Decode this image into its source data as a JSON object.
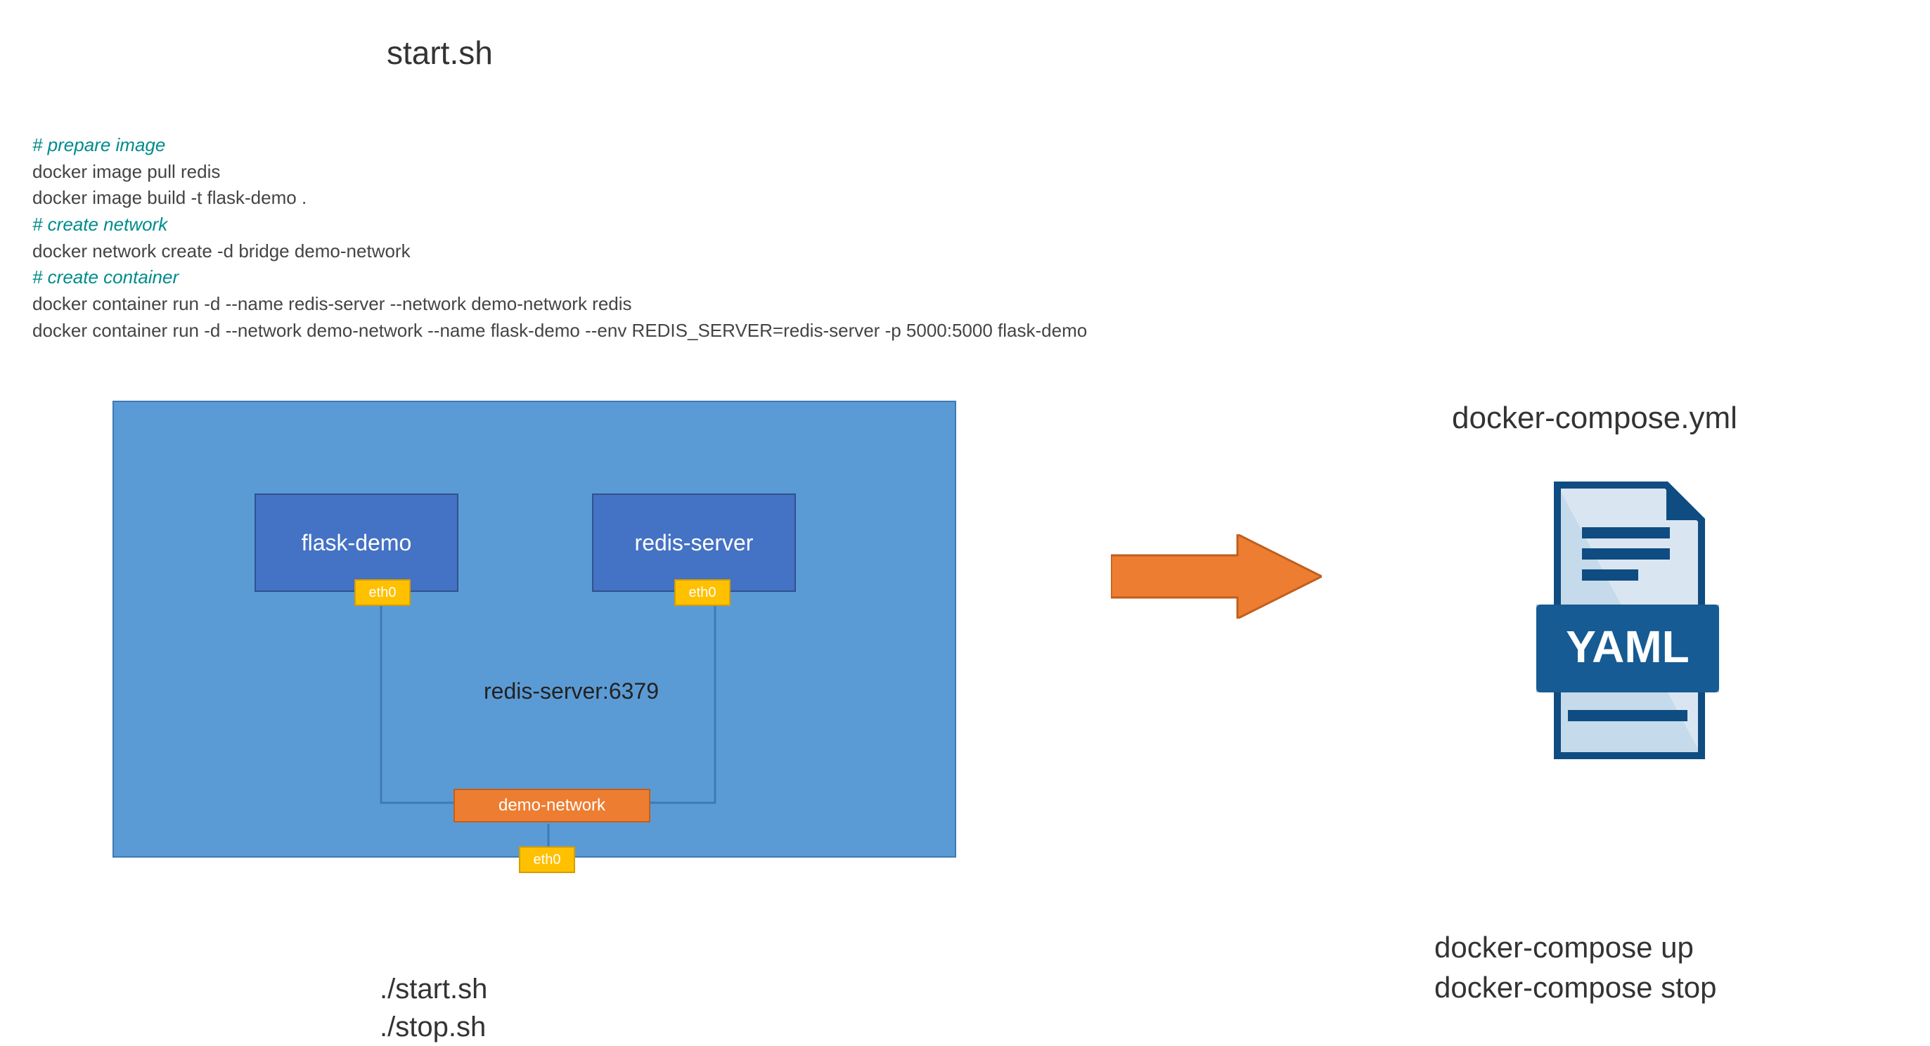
{
  "title": "start.sh",
  "script": {
    "comment1": "# prepare image",
    "line1": "docker image pull redis",
    "line2": "docker image build -t flask-demo .",
    "comment2": "# create network",
    "line3": "docker network create -d bridge demo-network",
    "comment3": "# create container",
    "line4": "docker container run -d --name redis-server --network demo-network redis",
    "line5": "docker container run -d --network demo-network --name flask-demo --env REDIS_SERVER=redis-server -p 5000:5000 flask-demo"
  },
  "diagram": {
    "container_flask": "flask-demo",
    "container_redis": "redis-server",
    "eth_label": "eth0",
    "redis_port": "redis-server:6379",
    "network_label": "demo-network"
  },
  "commands_left": {
    "line1": "./start.sh",
    "line2": "./stop.sh"
  },
  "compose": {
    "title": "docker-compose.yml",
    "yaml_label": "YAML"
  },
  "commands_right": {
    "line1": "docker-compose up",
    "line2": "docker-compose stop"
  },
  "colors": {
    "host_bg": "#5b9bd5",
    "container_bg": "#4472c4",
    "eth_bg": "#ffc000",
    "network_bg": "#ed7d31",
    "arrow": "#ed7d31",
    "yaml_dark": "#0f4c81",
    "yaml_light": "#1e6fa8"
  }
}
